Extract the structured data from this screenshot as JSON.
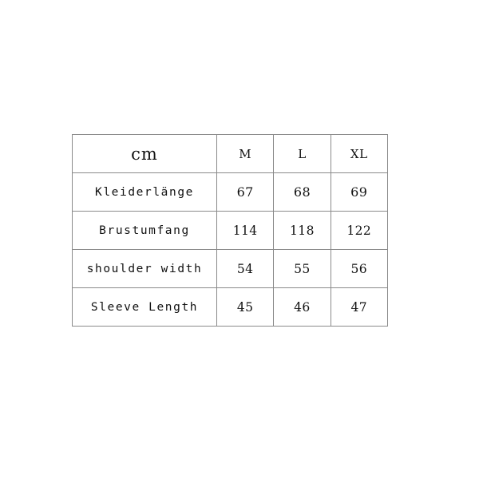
{
  "chart_data": {
    "type": "table",
    "title": "",
    "unit_label": "cm",
    "columns": [
      "cm",
      "M",
      "L",
      "XL"
    ],
    "categories": [
      "Kleiderlänge",
      "Brustumfang",
      "shoulder width",
      "Sleeve Length"
    ],
    "series": [
      {
        "name": "M",
        "values": [
          67,
          114,
          54,
          45
        ]
      },
      {
        "name": "L",
        "values": [
          68,
          118,
          55,
          46
        ]
      },
      {
        "name": "XL",
        "values": [
          69,
          122,
          56,
          47
        ]
      }
    ],
    "rows": [
      {
        "label": "Kleiderlänge",
        "M": "67",
        "L": "68",
        "XL": "69"
      },
      {
        "label": "Brustumfang",
        "M": "114",
        "L": "118",
        "XL": "122"
      },
      {
        "label": "shoulder width",
        "M": "54",
        "L": "55",
        "XL": "56"
      },
      {
        "label": "Sleeve Length",
        "M": "45",
        "L": "46",
        "XL": "47"
      }
    ],
    "grid": true,
    "legend": "none"
  },
  "table": {
    "header": {
      "unit": "cm",
      "sizes": [
        "M",
        "L",
        "XL"
      ]
    },
    "rows": [
      {
        "label": "Kleiderlänge",
        "values": [
          "67",
          "68",
          "69"
        ]
      },
      {
        "label": "Brustumfang",
        "values": [
          "114",
          "118",
          "122"
        ]
      },
      {
        "label": "shoulder width",
        "values": [
          "54",
          "55",
          "56"
        ]
      },
      {
        "label": "Sleeve Length",
        "values": [
          "45",
          "46",
          "47"
        ]
      }
    ]
  },
  "colors": {
    "background": "#ffffff",
    "border": "#8a8a8a",
    "text": "#111111",
    "text_faint": "#4a4a4a"
  }
}
